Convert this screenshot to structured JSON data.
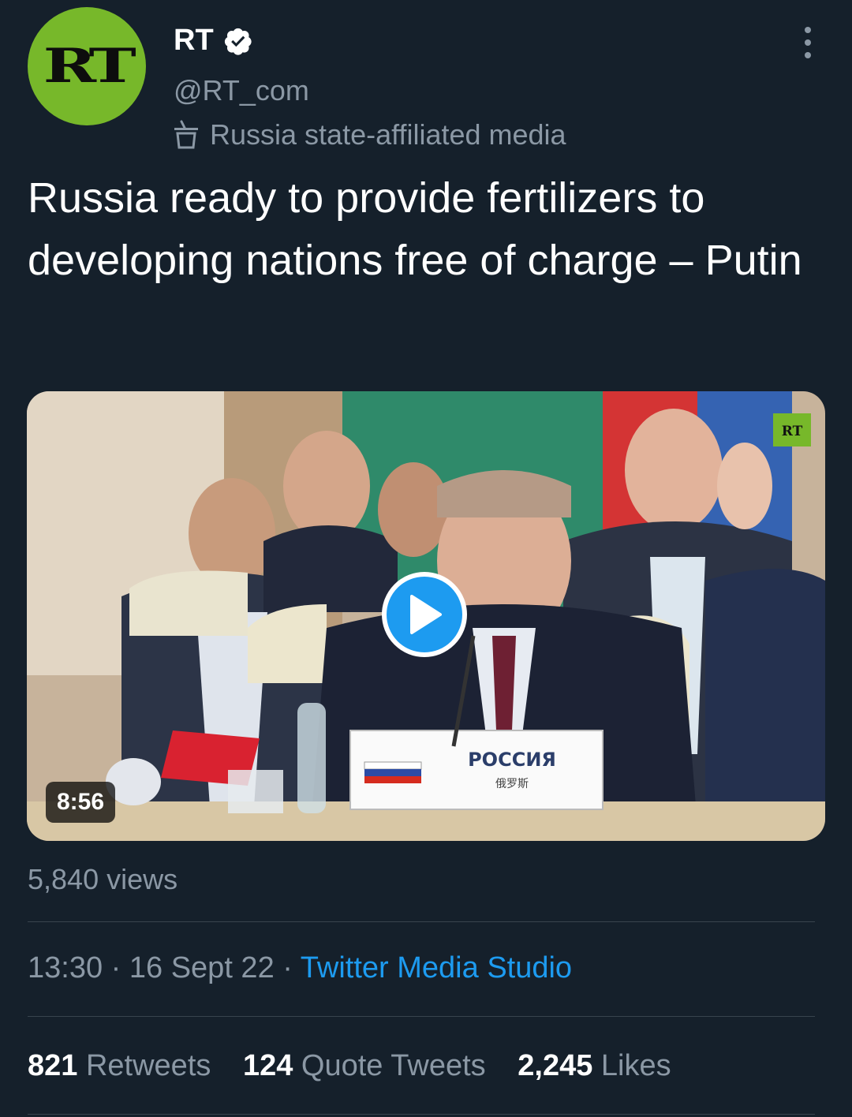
{
  "author": {
    "avatar_text": "RT",
    "display_name": "RT",
    "handle": "@RT_com",
    "affiliation": "Russia state-affiliated media",
    "avatar_color": "#77b82a"
  },
  "tweet": {
    "text": "Russia ready to provide fertilizers to developing nations free of charge – Putin"
  },
  "media": {
    "duration": "8:56",
    "views": "5,840 views",
    "nameplate": "РОССИЯ",
    "nameplate_sub": "俄罗斯",
    "watermark": "RT"
  },
  "meta": {
    "time": "13:30",
    "separator": "·",
    "date": "16 Sept 22",
    "source": "Twitter Media Studio"
  },
  "stats": {
    "retweets_count": "821",
    "retweets_label": "Retweets",
    "quotes_count": "124",
    "quotes_label": "Quote Tweets",
    "likes_count": "2,245",
    "likes_label": "Likes"
  },
  "colors": {
    "background": "#15202b",
    "secondary_text": "#8b98a5",
    "accent": "#1d9bf0"
  }
}
